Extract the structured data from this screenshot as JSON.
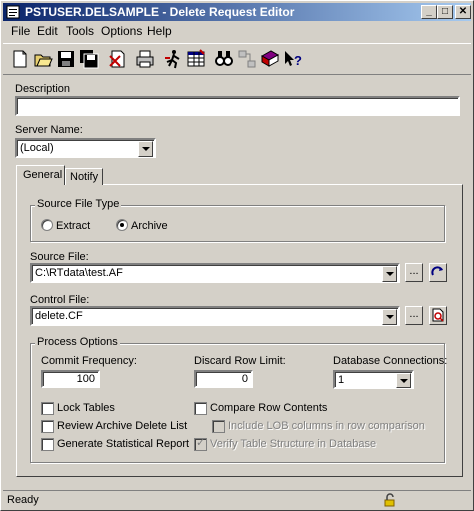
{
  "window": {
    "title": "PSTUSER.DELSAMPLE - Delete Request Editor"
  },
  "menu": [
    "File",
    "Edit",
    "Tools",
    "Options",
    "Help"
  ],
  "toolbar": [
    "new-icon",
    "open-icon",
    "save-icon",
    "save-all-icon",
    "delete-icon",
    "print-icon",
    "run-icon",
    "table-icon",
    "browse-icon",
    "relationships-icon",
    "book-icon",
    "help-icon"
  ],
  "description": {
    "label": "Description",
    "value": ""
  },
  "server": {
    "label": "Server Name:",
    "value": "(Local)"
  },
  "tabs": [
    {
      "label": "General",
      "active": true
    },
    {
      "label": "Notify",
      "active": false
    }
  ],
  "source_file_type": {
    "title": "Source File Type",
    "options": [
      {
        "label": "Extract",
        "selected": false
      },
      {
        "label": "Archive",
        "selected": true
      }
    ]
  },
  "source_file": {
    "label": "Source File:",
    "value": "C:\\RTdata\\test.AF",
    "browse": "..."
  },
  "control_file": {
    "label": "Control File:",
    "value": "delete.CF",
    "browse": "..."
  },
  "process_options": {
    "title": "Process Options",
    "commit_frequency": {
      "label": "Commit Frequency:",
      "value": "100"
    },
    "discard_row_limit": {
      "label": "Discard Row Limit:",
      "value": "0"
    },
    "database_connections": {
      "label": "Database Connections:",
      "value": "1"
    },
    "checkboxes": [
      {
        "label": "Lock Tables",
        "checked": false,
        "enabled": true
      },
      {
        "label": "Review Archive Delete List",
        "checked": false,
        "enabled": true
      },
      {
        "label": "Generate Statistical Report",
        "checked": false,
        "enabled": true
      },
      {
        "label": "Compare Row Contents",
        "checked": false,
        "enabled": true
      },
      {
        "label": "Include LOB columns in row comparison",
        "checked": false,
        "enabled": false
      },
      {
        "label": "Verify Table Structure in Database",
        "checked": true,
        "enabled": false
      }
    ]
  },
  "status": {
    "text": "Ready"
  }
}
